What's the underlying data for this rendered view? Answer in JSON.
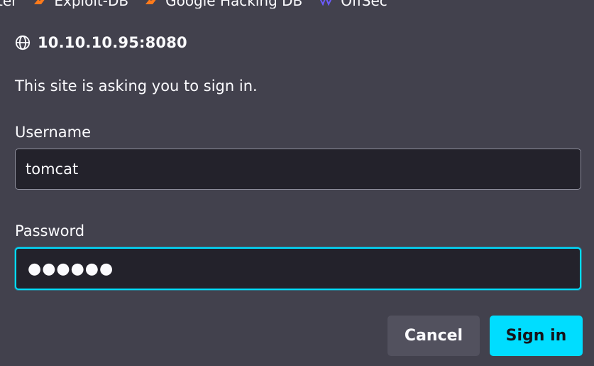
{
  "bookmarks": [
    {
      "label": "ter",
      "icon": "none"
    },
    {
      "label": "Exploit-DB",
      "icon": "flame-icon"
    },
    {
      "label": "Google Hacking DB",
      "icon": "flame-icon"
    },
    {
      "label": "OffSec",
      "icon": "offsec-icon"
    }
  ],
  "dialog": {
    "site_icon": "globe-icon",
    "host": "10.10.10.95:8080",
    "message": "This site is asking you to sign in.",
    "username_label": "Username",
    "username_value": "tomcat",
    "password_label": "Password",
    "password_value": "●●●●●●",
    "cancel_label": "Cancel",
    "signin_label": "Sign in"
  },
  "colors": {
    "background": "#42414d",
    "field_background": "#23222b",
    "accent": "#00ddff",
    "cancel_button": "#52515e",
    "text": "#fbfbfe"
  }
}
